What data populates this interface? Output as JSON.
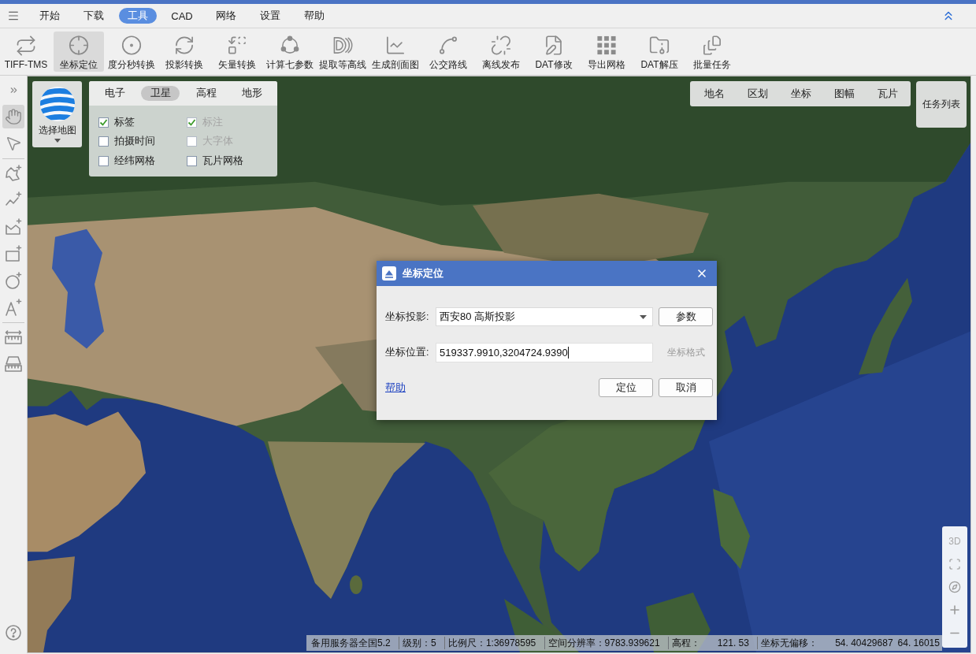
{
  "menu_bar": {
    "items": [
      {
        "label": "开始",
        "selected": false
      },
      {
        "label": "下载",
        "selected": false
      },
      {
        "label": "工具",
        "selected": true
      },
      {
        "label": "CAD",
        "selected": false
      },
      {
        "label": "网络",
        "selected": false
      },
      {
        "label": "设置",
        "selected": false
      },
      {
        "label": "帮助",
        "selected": false
      }
    ]
  },
  "toolbar": {
    "items": [
      {
        "kind": "loop",
        "label": "TIFF-TMS",
        "selected": false
      },
      {
        "kind": "crosshair",
        "label": "坐标定位",
        "selected": true
      },
      {
        "kind": "dot",
        "label": "度分秒转换",
        "selected": false
      },
      {
        "kind": "rotate",
        "label": "投影转换",
        "selected": false
      },
      {
        "kind": "swap",
        "label": "矢量转换",
        "selected": false
      },
      {
        "kind": "nodes",
        "label": "计算七参数",
        "selected": false
      },
      {
        "kind": "contour",
        "label": "提取等高线",
        "selected": false
      },
      {
        "kind": "chart",
        "label": "生成剖面图",
        "selected": false
      },
      {
        "kind": "curve",
        "label": "公交路线",
        "selected": false
      },
      {
        "kind": "unlink",
        "label": "离线发布",
        "selected": false
      },
      {
        "kind": "edit",
        "label": "DAT修改",
        "selected": false
      },
      {
        "kind": "grid",
        "label": "导出网格",
        "selected": false
      },
      {
        "kind": "archive",
        "label": "DAT解压",
        "selected": false
      },
      {
        "kind": "stack",
        "label": "批量任务",
        "selected": false
      }
    ]
  },
  "side_toolbar": {
    "groups": [
      {
        "tools": [
          {
            "kind": "expand",
            "selected": false
          },
          {
            "kind": "pan",
            "selected": true
          },
          {
            "kind": "pointer",
            "selected": false
          }
        ]
      },
      {
        "tools": [
          {
            "kind": "polygon",
            "selected": false
          },
          {
            "kind": "polyline",
            "selected": false
          },
          {
            "kind": "area",
            "selected": false
          },
          {
            "kind": "rectangle",
            "selected": false
          },
          {
            "kind": "circle",
            "selected": false
          },
          {
            "kind": "text",
            "selected": false
          }
        ]
      },
      {
        "tools": [
          {
            "kind": "ruler",
            "selected": false
          },
          {
            "kind": "measure",
            "selected": false
          }
        ]
      }
    ]
  },
  "map_selector": {
    "label": "选择地图"
  },
  "layer_panel": {
    "tabs": [
      {
        "label": "电子",
        "selected": false
      },
      {
        "label": "卫星",
        "selected": true
      },
      {
        "label": "高程",
        "selected": false
      },
      {
        "label": "地形",
        "selected": false
      }
    ],
    "options": [
      {
        "label": "标签",
        "checked": true,
        "disabled": false
      },
      {
        "label": "标注",
        "checked": true,
        "disabled": true
      },
      {
        "label": "拍摄时间",
        "checked": false,
        "disabled": false
      },
      {
        "label": "大字体",
        "checked": false,
        "disabled": true
      },
      {
        "label": "经纬网格",
        "checked": false,
        "disabled": false
      },
      {
        "label": "瓦片网格",
        "checked": false,
        "disabled": false
      }
    ]
  },
  "query_tabs": [
    "地名",
    "区划",
    "坐标",
    "图幅",
    "瓦片"
  ],
  "task_list_button": {
    "label": "任务列表"
  },
  "dialog": {
    "title": "坐标定位",
    "projection": {
      "label": "坐标投影:",
      "value": "西安80 高斯投影"
    },
    "params_button": {
      "label": "参数"
    },
    "position": {
      "label": "坐标位置:",
      "value": "519337.9910,3204724.9390"
    },
    "format_button": {
      "label": "坐标格式",
      "disabled": true
    },
    "help_link": {
      "label": "帮助"
    },
    "buttons": [
      {
        "label": "定位"
      },
      {
        "label": "取消"
      }
    ]
  },
  "status_bar": {
    "items": [
      {
        "label": "备用服务器全国5.2"
      },
      {
        "label": "级别：5"
      },
      {
        "label": "比例尺：1:36978595"
      },
      {
        "label": "空间分辨率：9783.939621"
      },
      {
        "label": "高程：",
        "values": [
          "121. 53"
        ]
      },
      {
        "label": "坐标无偏移：",
        "values": [
          "54. 40429687",
          "64. 16015"
        ]
      }
    ]
  },
  "view_controls": {
    "mode_label": "3D"
  }
}
